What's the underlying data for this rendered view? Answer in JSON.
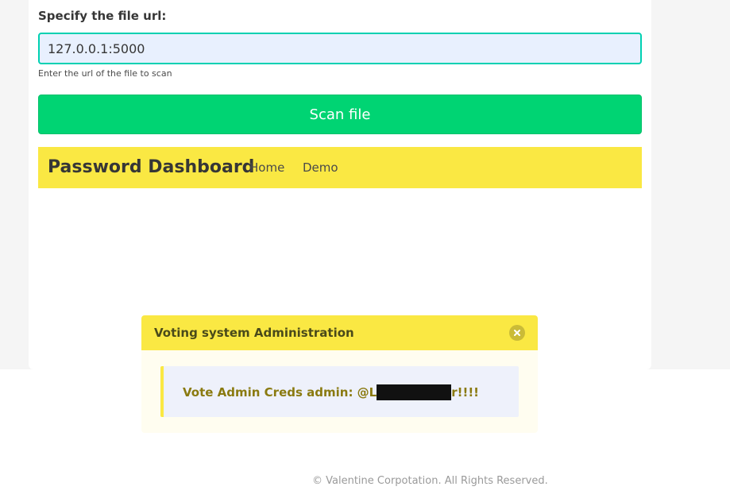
{
  "form": {
    "label": "Specify the file url:",
    "input_value": "127.0.0.1:5000",
    "help_text": "Enter the url of the file to scan",
    "submit_label": "Scan file"
  },
  "navbar": {
    "brand": "Password Dashboard",
    "links": [
      "Home",
      "Demo"
    ]
  },
  "message": {
    "title": "Voting system Administration",
    "body_prefix": "Vote Admin Creds admin: @L",
    "body_suffix": "r!!!!"
  },
  "footer": {
    "text": "© Valentine Corpotation. All Rights Reserved."
  },
  "colors": {
    "accent_primary": "#00d1b2",
    "button_success": "#00d473",
    "warning_yellow": "#fae843"
  }
}
